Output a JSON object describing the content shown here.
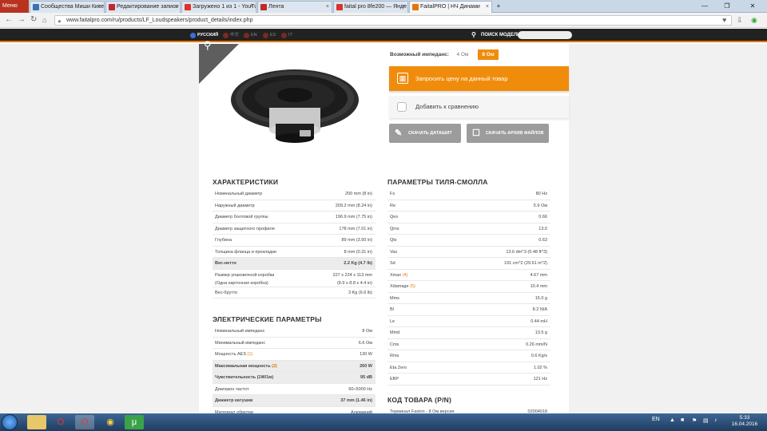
{
  "browser": {
    "menu_label": "Меню",
    "tabs": [
      {
        "title": "Сообщества Миши Кисе",
        "active": false,
        "color": "#3b6fb6"
      },
      {
        "title": "Редактирование записи",
        "active": false,
        "color": "#c0282d"
      },
      {
        "title": "Загружено 1 из 1 - YouTu",
        "active": false,
        "color": "#e52d27"
      },
      {
        "title": "Лента",
        "active": false,
        "color": "#c0282d"
      },
      {
        "title": "faital pro 8fe200 — Янде",
        "active": false,
        "color": "#d9342b"
      },
      {
        "title": "FaitalPRO | НЧ Динами",
        "active": true,
        "color": "#e2760e"
      }
    ],
    "new_tab_label": "+",
    "address": "www.faitalpro.com/ru/products/LF_Loudspeakers/product_details/index.php"
  },
  "site": {
    "accent_color": "#e2760e",
    "languages": [
      {
        "label": "РУССКИЙ",
        "active": true
      },
      {
        "label": "中文",
        "active": false
      },
      {
        "label": "EN",
        "active": false
      },
      {
        "label": "ES",
        "active": false
      },
      {
        "label": "IT",
        "active": false
      }
    ],
    "search_label": "ПОИСК МОДЕЛИ"
  },
  "product": {
    "impedance_label": "Возможный импеданс:",
    "impedance_options": [
      {
        "label": "4 Ом",
        "selected": false
      },
      {
        "label": "8 Ом",
        "selected": true
      }
    ],
    "price_button": "Запросить цену на данный товар",
    "compare_button": "Добавить к сравнению",
    "datasheet_button": "СКАЧАТЬ ДАТАШИТ",
    "archive_button": "СКАЧАТЬ АРХИВ ФАЙЛОВ"
  },
  "characteristics": {
    "title": "ХАРАКТЕРИСТИКИ",
    "rows": [
      {
        "label": "Номинальный диаметр",
        "value": "200 mm (8 in)"
      },
      {
        "label": "Наружный диаметр",
        "value": "209.2 mm (8.24 in)"
      },
      {
        "label": "Диаметр болтовой группы",
        "value": "196.9 mm (7.75 in)"
      },
      {
        "label": "Диаметр защитного профиля",
        "value": "178 mm (7.01 in)"
      },
      {
        "label": "Глубина",
        "value": "89 mm (3.50 in)"
      },
      {
        "label": "Толщина фланца и прокладки",
        "value": "8 mm (0.31 in)"
      },
      {
        "label": "Вес-нетто",
        "value": "2.2 Kg (4.7 lb)",
        "highlight": true
      },
      {
        "label": "Размер упаковочной коробки",
        "label2": "(Одна картонная коробка)",
        "value": "227 x 224 x 113 mm",
        "value2": "(8.9 x 8.8 x 4.4 in)",
        "tall": true
      },
      {
        "label": "Вес-брутто",
        "value": "3 Kg (6.6 lb)"
      }
    ]
  },
  "electrical": {
    "title": "ЭЛЕКТРИЧЕСКИЕ ПАРАМЕТРЫ",
    "rows": [
      {
        "label": "Номинальный импеданс",
        "value": "8 Ом"
      },
      {
        "label": "Минимальный импеданс",
        "value": "6.6 Ом"
      },
      {
        "label": "Мощность AES",
        "note": "(1)",
        "value": "130 W"
      },
      {
        "label": "Максимальная мощность",
        "note": "(2)",
        "value": "260 W",
        "highlight": true
      },
      {
        "label": "Чувствительность (1W/1м)",
        "value": "95 dB",
        "highlight": true
      },
      {
        "label": "Диапазон частот",
        "value": "60÷5000 Hz"
      },
      {
        "label": "Диаметр катушки",
        "value": "37 mm (1.46 in)",
        "highlight": true
      },
      {
        "label": "Материал обмотки",
        "value": "Алюминий"
      }
    ]
  },
  "thiele_small": {
    "title": "ПАРАМЕТРЫ ТИЛЯ-СМОЛЛА",
    "rows": [
      {
        "label": "Fs",
        "value": "80 Hz"
      },
      {
        "label": "Re",
        "value": "5.9 Ом"
      },
      {
        "label": "Qes",
        "value": "0.66"
      },
      {
        "label": "Qms",
        "value": "13.0"
      },
      {
        "label": "Qts",
        "value": "0.63"
      },
      {
        "label": "Vas",
        "value": "13.6 dm^3 (0.48 ft^3)"
      },
      {
        "label": "Sd",
        "value": "191 cm^2 (29.61 in^2)"
      },
      {
        "label": "Xmax",
        "note": "(4)",
        "value": "4.67 mm"
      },
      {
        "label": "Xdamage",
        "note": "(5)",
        "value": "10.4 mm"
      },
      {
        "label": "Mms",
        "value": "15.0 g"
      },
      {
        "label": "Bl",
        "value": "8.2 N/A"
      },
      {
        "label": "Le",
        "value": "0.44 mH"
      },
      {
        "label": "Mmd",
        "value": "13.5 g"
      },
      {
        "label": "Cms",
        "value": "0.26 mm/N"
      },
      {
        "label": "Rms",
        "value": "0.6 Kg/s"
      },
      {
        "label": "Eta Zero",
        "value": "1.02 %"
      },
      {
        "label": "EBP",
        "value": "121 Hz"
      }
    ]
  },
  "product_code": {
    "title": "КОД ТОВАРА (P/N)",
    "rows": [
      {
        "label": "Терминал Faston - 8 Ом версия",
        "value": "02004018"
      }
    ]
  },
  "taskbar": {
    "lang": "EN",
    "time": "5:33",
    "date": "16.04.2016"
  }
}
